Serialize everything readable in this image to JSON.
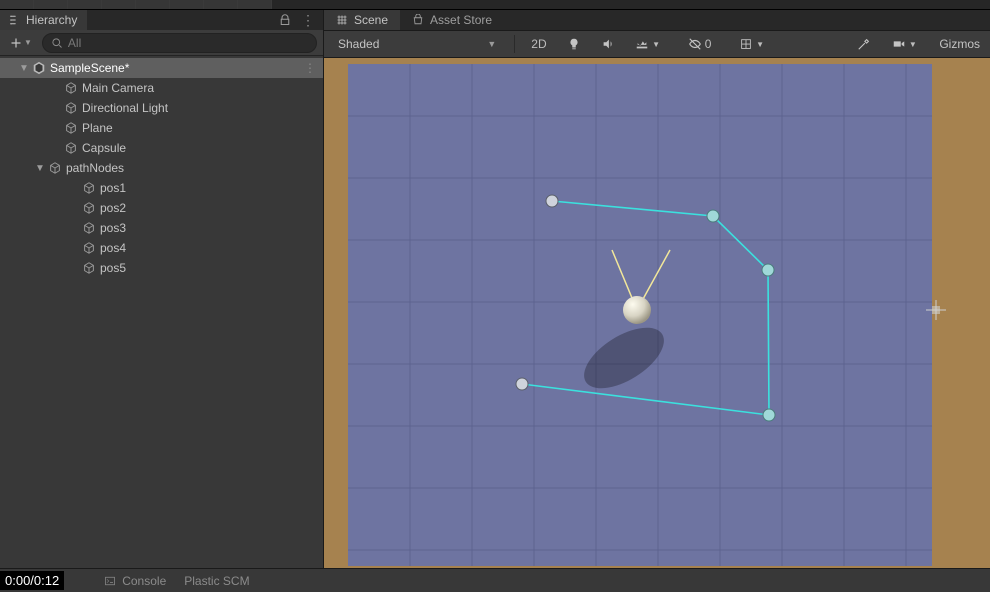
{
  "hierarchy": {
    "panel_label": "Hierarchy",
    "search_placeholder": "All",
    "scene_name": "SampleScene*",
    "items": [
      "Main Camera",
      "Directional Light",
      "Plane",
      "Capsule"
    ],
    "path_group": "pathNodes",
    "path_children": [
      "pos1",
      "pos2",
      "pos3",
      "pos4",
      "pos5"
    ]
  },
  "scene": {
    "tab_scene": "Scene",
    "tab_asset_store": "Asset Store",
    "shading_mode": "Shaded",
    "btn_2d": "2D",
    "visibility_count": "0",
    "gizmos": "Gizmos"
  },
  "bottom": {
    "time": "0:00/0:12",
    "console": "Console",
    "plastic": "Plastic SCM"
  },
  "colors": {
    "path_line": "#3be1de",
    "plane": "#7278a0",
    "border": "#a6824f"
  }
}
